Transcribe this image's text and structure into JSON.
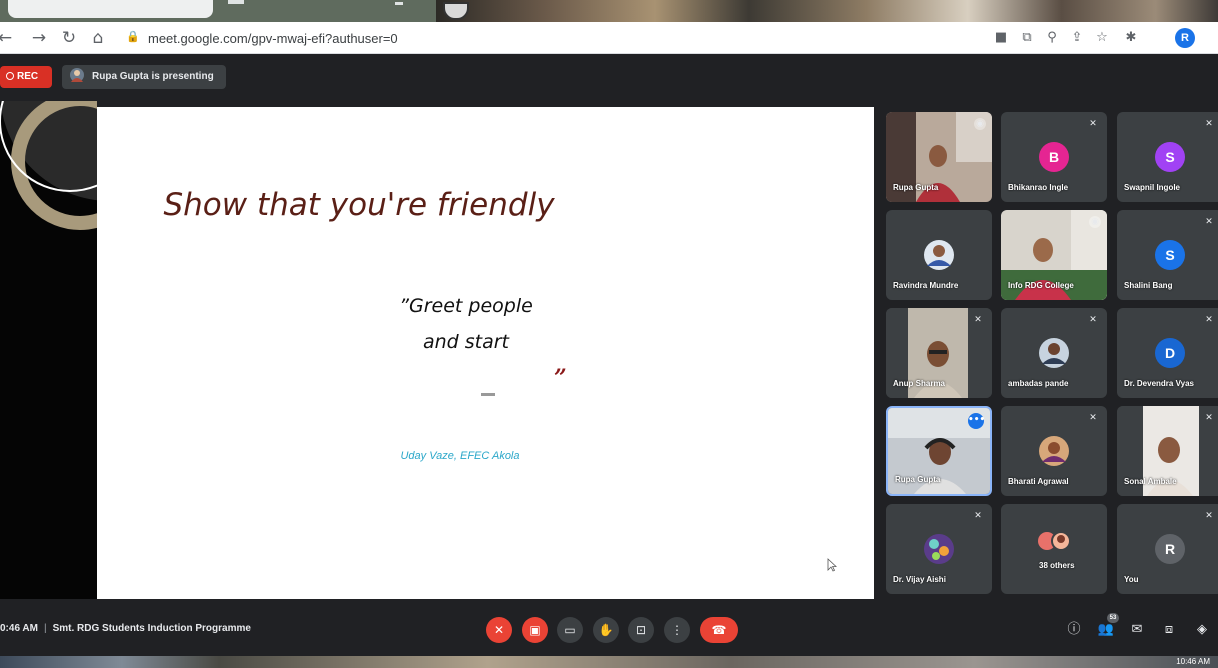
{
  "browser": {
    "url": "meet.google.com/gpv-mwaj-efi?authuser=0",
    "profile_initial": "R"
  },
  "meet_header": {
    "rec_label": "REC",
    "presenting_text": "Rupa Gupta is presenting"
  },
  "slide": {
    "title": "Show that you're friendly",
    "quote_lines": [
      "”Greet people",
      "and start"
    ],
    "closing_quote": "”",
    "author": "Uday Vaze, EFEC Akola"
  },
  "participants": [
    {
      "name": "Rupa Gupta",
      "type": "video"
    },
    {
      "name": "Bhikanrao Ingle",
      "initial": "B",
      "color": "#e52592"
    },
    {
      "name": "Swapnil Ingole",
      "initial": "S",
      "color": "#a142f4"
    },
    {
      "name": "Ravindra Mundre",
      "type": "photo"
    },
    {
      "name": "Info RDG College",
      "type": "video"
    },
    {
      "name": "Shalini Bang",
      "initial": "S",
      "color": "#1a73e8"
    },
    {
      "name": "Anup Sharma",
      "type": "video"
    },
    {
      "name": "ambadas pande",
      "type": "photo"
    },
    {
      "name": "Dr. Devendra Vyas",
      "initial": "D",
      "color": "#1967d2"
    },
    {
      "name": "Rupa Gupta",
      "type": "video",
      "active": true
    },
    {
      "name": "Bharati Agrawal",
      "type": "photo"
    },
    {
      "name": "Sonal Ambale",
      "type": "video"
    },
    {
      "name": "Dr. Vijay Aishi",
      "type": "photo"
    },
    {
      "name": "38 others",
      "type": "group"
    },
    {
      "name": "You",
      "initial": "R",
      "color": "#5f6368"
    }
  ],
  "bottom_bar": {
    "time": "0:46 AM",
    "meeting_title": "Smt. RDG Students Induction Programme",
    "people_count": "53"
  },
  "taskbar": {
    "clock": "10:46 AM"
  },
  "colors": {
    "meet_bg": "#202124",
    "tile_bg": "#3c4043",
    "danger": "#ea4335",
    "title_brown": "#5a1f16",
    "author_teal": "#2aa7c9"
  }
}
